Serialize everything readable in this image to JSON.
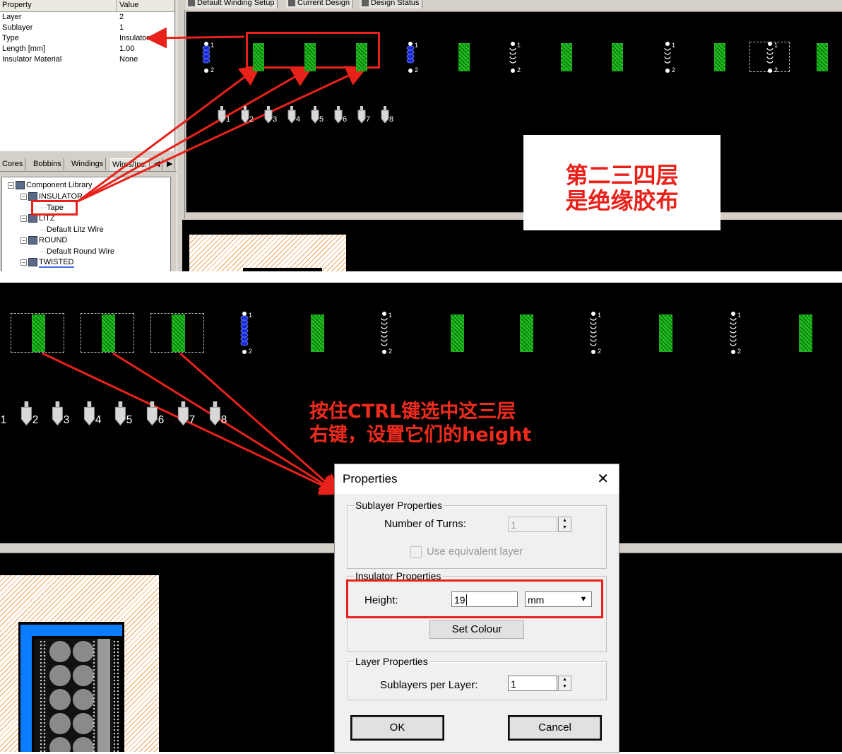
{
  "property_table": {
    "header": {
      "property": "Property",
      "value": "Value"
    },
    "rows": [
      {
        "key": "Layer",
        "value": "2"
      },
      {
        "key": "Sublayer",
        "value": "1"
      },
      {
        "key": "Type",
        "value": "Insulator"
      },
      {
        "key": "Length [mm]",
        "value": "1.00"
      },
      {
        "key": "Insulator Material",
        "value": "None"
      }
    ]
  },
  "library_tabs": [
    "Cores",
    "Bobbins",
    "Windings",
    "Wires/Ins."
  ],
  "tree": {
    "root": "Component Library",
    "insulator": "INSULATOR",
    "tape": "Tape",
    "litz": "LITZ",
    "litz_item": "Default Litz Wire",
    "round": "ROUND",
    "round_item": "Default Round Wire",
    "twisted": "TWISTED"
  },
  "main_tabs": [
    "Default Winding Setup",
    "Current Design",
    "Design Status"
  ],
  "pins_top": [
    "1",
    "2",
    "3",
    "4",
    "5",
    "6",
    "7",
    "8"
  ],
  "pins_bottom": [
    "1",
    "2",
    "3",
    "4",
    "5",
    "6",
    "7",
    "8"
  ],
  "winding_labels": {
    "start": "1",
    "end": "2"
  },
  "annotations": {
    "note1_line1": "第二三四层",
    "note1_line2": "是绝缘胶布",
    "note2_line1": "按住CTRL键选中这三层",
    "note2_line2": "右键，设置它们的height"
  },
  "dialog": {
    "title": "Properties",
    "close": "✕",
    "sublayer_group": "Sublayer Properties",
    "turns_label": "Number of Turns:",
    "turns_value": "1",
    "equiv_label": "Use equivalent layer",
    "insulator_group": "Insulator Properties",
    "height_label": "Height:",
    "height_value": "19",
    "unit_value": "mm",
    "set_colour": "Set Colour",
    "layer_group": "Layer Properties",
    "sublayers_label": "Sublayers per Layer:",
    "sublayers_value": "1",
    "ok": "OK",
    "cancel": "Cancel"
  },
  "colors": {
    "accent_red": "#e8221a",
    "tape_green": "#1fae1f",
    "winding_blue": "#1a2bd6",
    "coil_blue": "#0b7cff"
  }
}
